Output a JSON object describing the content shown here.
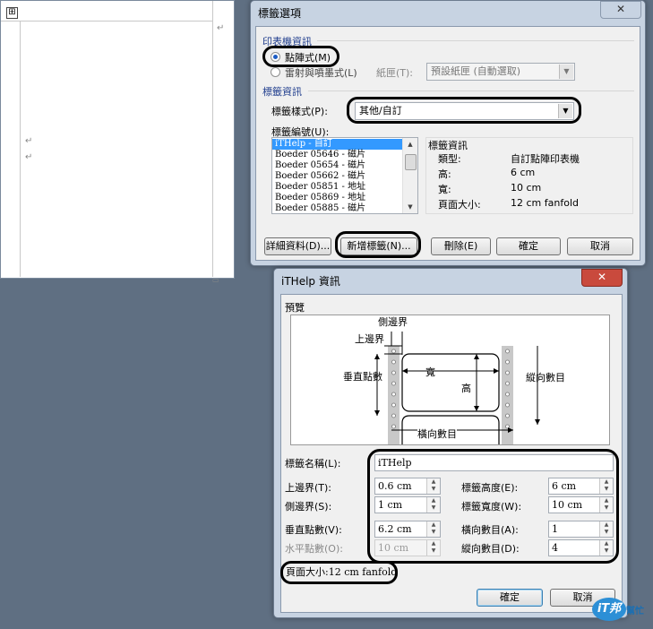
{
  "document": {
    "handle_glyph": "⊞",
    "para_mark": "↵"
  },
  "label_options": {
    "title": "標籤選項",
    "close_glyph": "✕",
    "printer_info": {
      "group": "印表機資訊",
      "dot_matrix": "點陣式(M)",
      "laser_inkjet": "雷射與噴墨式(L)",
      "tray_label": "紙匣(T):",
      "tray_value": "預設紙匣 (自動選取)"
    },
    "label_info": {
      "group": "標籤資訊",
      "vendor_label": "標籤樣式(P):",
      "vendor_value": "其他/自訂",
      "product_label": "標籤編號(U):",
      "products": [
        "iTHelp - 自訂",
        "Boeder 05646 - 磁片",
        "Boeder 05654 - 磁片",
        "Boeder 05662 - 磁片",
        "Boeder 05851 - 地址",
        "Boeder 05869 - 地址",
        "Boeder 05885 - 磁片"
      ],
      "selected_index": 0
    },
    "details": {
      "group": "標籤資訊",
      "rows": [
        {
          "k": "類型:",
          "v": "自訂點陣印表機"
        },
        {
          "k": "高:",
          "v": "6 cm"
        },
        {
          "k": "寬:",
          "v": "10 cm"
        },
        {
          "k": "頁面大小:",
          "v": "12 cm fanfold"
        }
      ]
    },
    "buttons": {
      "details": "詳細資料(D)...",
      "new_label": "新增標籤(N)...",
      "delete": "刪除(E)",
      "ok": "確定",
      "cancel": "取消"
    }
  },
  "ithelp_info": {
    "title": "iTHelp 資訊",
    "close_glyph": "✕",
    "preview": {
      "group": "預覽",
      "side_margin": "側邊界",
      "top_margin": "上邊界",
      "vertical_pitch": "垂直點數",
      "width": "寬",
      "height": "高",
      "number_down": "縱向數目",
      "number_across": "橫向數目"
    },
    "fields": {
      "label_name": {
        "label": "標籤名稱(L):",
        "value": "iTHelp"
      },
      "top_margin": {
        "label": "上邊界(T):",
        "value": "0.6 cm"
      },
      "side_margin": {
        "label": "側邊界(S):",
        "value": "1 cm"
      },
      "vertical_pitch": {
        "label": "垂直點數(V):",
        "value": "6.2 cm"
      },
      "horizontal_pitch": {
        "label": "水平點數(O):",
        "value": "10 cm"
      },
      "label_height": {
        "label": "標籤高度(E):",
        "value": "6 cm"
      },
      "label_width": {
        "label": "標籤寬度(W):",
        "value": "10 cm"
      },
      "number_across": {
        "label": "橫向數目(A):",
        "value": "1"
      },
      "number_down": {
        "label": "縱向數目(D):",
        "value": "4"
      }
    },
    "page_size": "頁面大小:12 cm fanfold",
    "buttons": {
      "ok": "確定",
      "cancel": "取消"
    }
  },
  "watermark": {
    "brand": "iT邦",
    "sub": "幫忙"
  }
}
